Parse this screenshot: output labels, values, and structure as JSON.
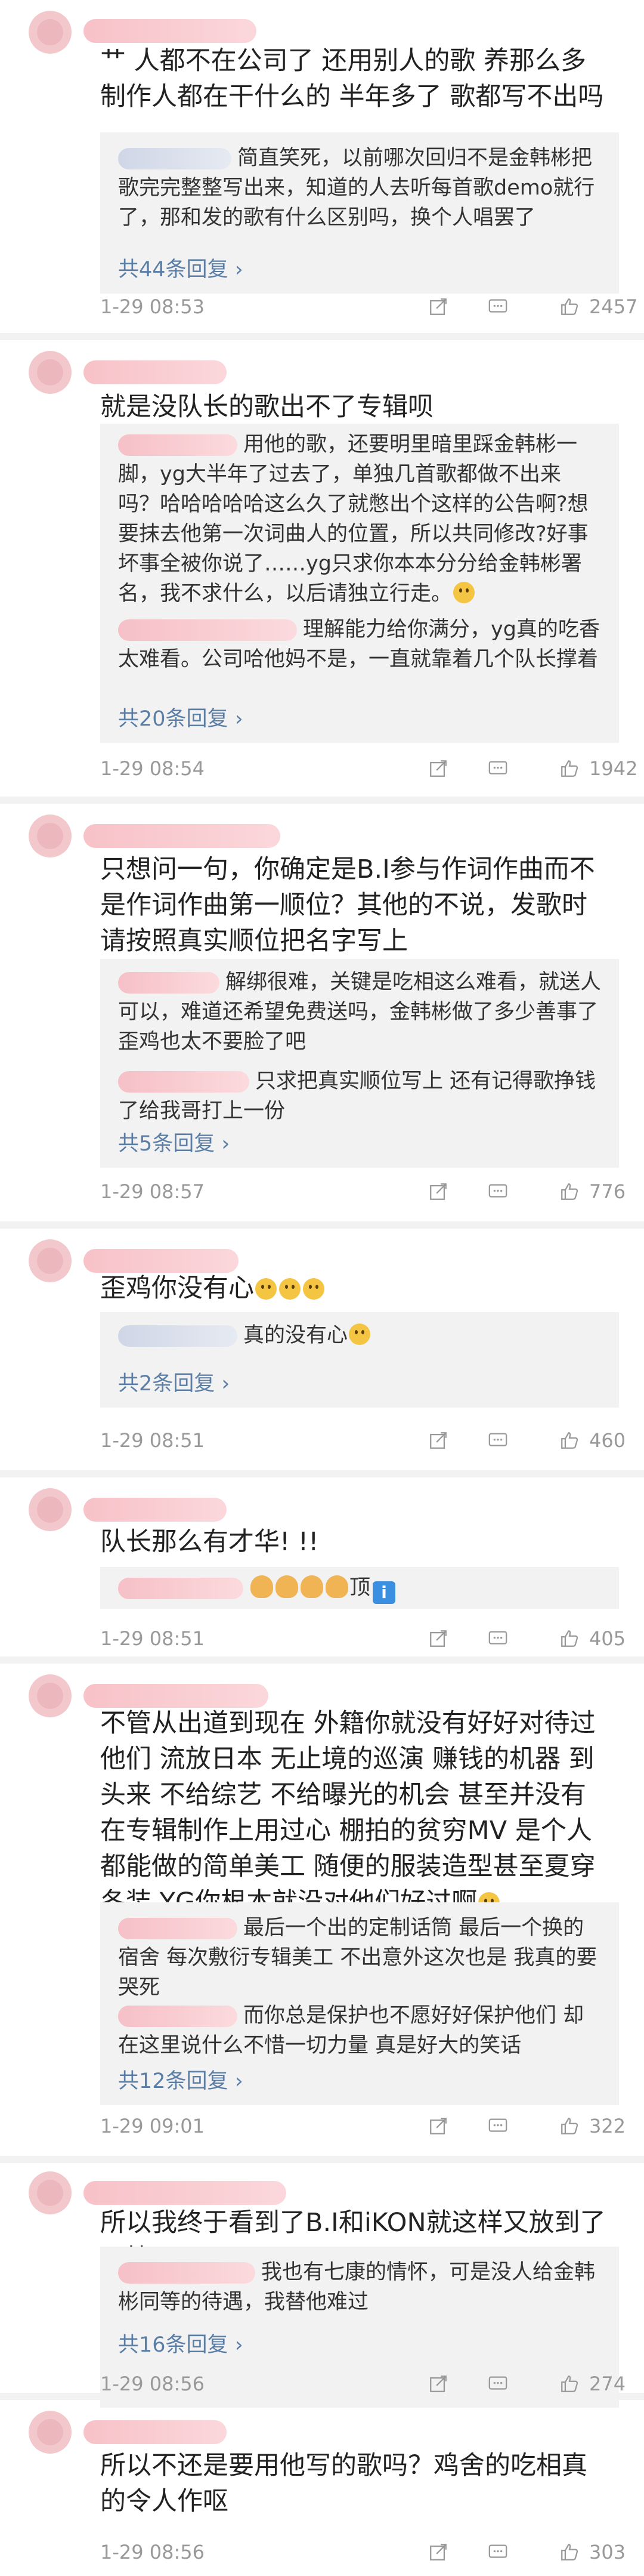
{
  "comments": [
    {
      "text": "艹 人都不在公司了 还用别人的歌 养那么多制作人都在干什么的 半年多了 歌都写不出吗",
      "replies": [
        {
          "text": "简直笑死，以前哪次回归不是金韩彬把歌完完整整写出来，知道的人去听每首歌demo就行了，那和发的歌有什么区别吗，换个人唱罢了"
        }
      ],
      "more": "共44条回复",
      "time": "1-29 08:53",
      "likes": "2457"
    },
    {
      "text": "就是没队长的歌出不了专辑呗",
      "replies": [
        {
          "text": "用他的歌，还要明里暗里踩金韩彬一脚，yg大半年了过去了，单独几首歌都做不出来吗？哈哈哈哈哈这么久了就憋出个这样的公告啊?想要抹去他第一次词曲人的位置，所以共同修改?好事坏事全被你说了……yg只求你本本分分给金韩彬署名，我不求什么，以后请独立行走。"
        },
        {
          "text": "理解能力给你满分，yg真的吃香太难看。公司哈他妈不是，一直就靠着几个队长撑着"
        }
      ],
      "more": "共20条回复",
      "time": "1-29 08:54",
      "likes": "1942"
    },
    {
      "text": "只想问一句，你确定是B.I参与作词作曲而不是作词作曲第一顺位？其他的不说，发歌时请按照真实顺位把名字写上",
      "replies": [
        {
          "text": "解绑很难，关键是吃相这么难看，就送人可以，难道还希望免费送吗，金韩彬做了多少善事了歪鸡也太不要脸了吧"
        },
        {
          "text": "只求把真实顺位写上 还有记得歌挣钱了给我哥打上一份"
        }
      ],
      "more": "共5条回复",
      "time": "1-29 08:57",
      "likes": "776"
    },
    {
      "text": "歪鸡你没有心",
      "replies": [
        {
          "text": "真的没有心"
        }
      ],
      "more": "共2条回复",
      "time": "1-29 08:51",
      "likes": "460"
    },
    {
      "text": "队长那么有才华! !!",
      "replies": [
        {
          "text": "顶"
        }
      ],
      "more": "",
      "time": "1-29 08:51",
      "likes": "405"
    },
    {
      "text": "不管从出道到现在 外籍你就没有好好对待过他们 流放日本 无止境的巡演 赚钱的机器 到头来 不给综艺 不给曝光的机会 甚至并没有在专辑制作上用过心 棚拍的贫穷MV 是个人都能做的简单美工 随便的服装造型甚至夏穿冬装 YG你根本就没对他们好过啊",
      "replies": [
        {
          "text": "最后一个出的定制话筒 最后一个换的宿舍 每次敷衍专辑美工 不出意外这次也是 我真的要哭死"
        },
        {
          "text": "而你总是保护也不愿好好保护他们 却在这里说什么不惜一切力量 真是好大的笑话"
        }
      ],
      "more": "共12条回复",
      "time": "1-29 09:01",
      "likes": "322"
    },
    {
      "text": "所以我终于看到了B.I和iKON就这样又放到了一块",
      "replies": [
        {
          "text": "我也有七康的情怀，可是没人给金韩彬同等的待遇，我替他难过"
        }
      ],
      "more": "共16条回复",
      "time": "1-29 08:56",
      "likes": "274"
    },
    {
      "text": "所以不还是要用他写的歌吗？鸡舍的吃相真的令人作呕",
      "replies": [],
      "more": "",
      "time": "1-29 08:56",
      "likes": "303"
    }
  ],
  "icons": {
    "share": "share-icon",
    "comment": "comment-icon",
    "like": "thumbs-up-icon",
    "more": "chevron-right-icon"
  },
  "colors": {
    "link": "#5b7ea6",
    "quote_bg": "#f2f2f2",
    "meta": "#999999"
  }
}
